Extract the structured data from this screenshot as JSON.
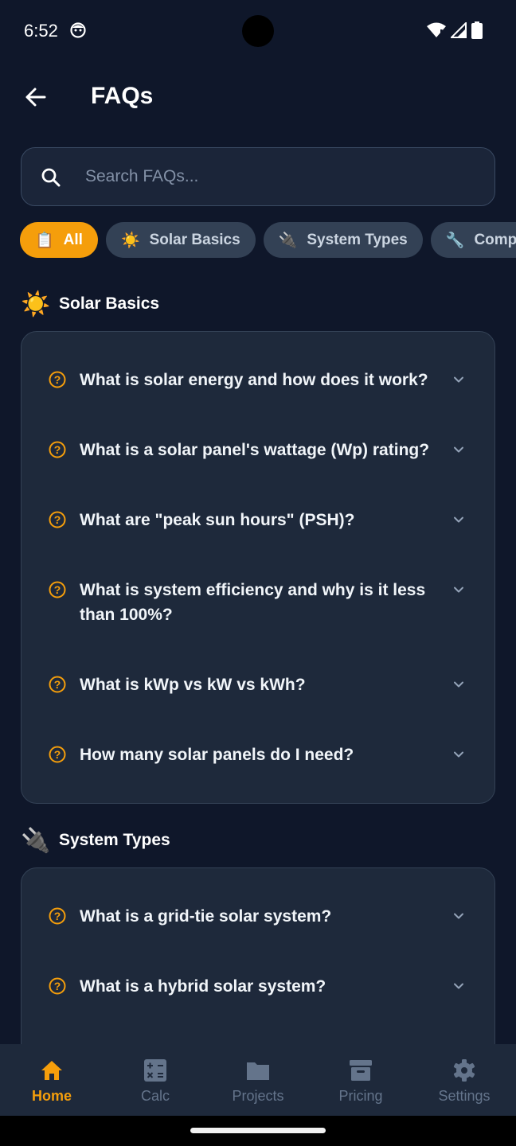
{
  "status_bar": {
    "time": "6:52"
  },
  "header": {
    "title": "FAQs"
  },
  "search": {
    "placeholder": "Search FAQs..."
  },
  "chips": [
    {
      "emoji": "📋",
      "label": "All",
      "active": true
    },
    {
      "emoji": "☀️",
      "label": "Solar Basics",
      "active": false
    },
    {
      "emoji": "🔌",
      "label": "System Types",
      "active": false
    },
    {
      "emoji": "🔧",
      "label": "Components",
      "active": false
    }
  ],
  "sections": [
    {
      "emoji": "☀️",
      "title": "Solar Basics",
      "questions": [
        "What is solar energy and how does it work?",
        "What is a solar panel's wattage (Wp) rating?",
        "What are \"peak sun hours\" (PSH)?",
        "What is system efficiency and why is it less than 100%?",
        "What is kWp vs kW vs kWh?",
        "How many solar panels do I need?"
      ]
    },
    {
      "emoji": "🔌",
      "title": "System Types",
      "questions": [
        "What is a grid-tie solar system?",
        "What is a hybrid solar system?"
      ]
    }
  ],
  "bottom_nav": [
    {
      "label": "Home",
      "icon": "home-icon",
      "active": true
    },
    {
      "label": "Calc",
      "icon": "calculator-icon",
      "active": false
    },
    {
      "label": "Projects",
      "icon": "folder-icon",
      "active": false
    },
    {
      "label": "Pricing",
      "icon": "archive-icon",
      "active": false
    },
    {
      "label": "Settings",
      "icon": "gear-icon",
      "active": false
    }
  ],
  "colors": {
    "accent": "#f59e0b",
    "background": "#0f172a",
    "card": "#1e293b",
    "chip": "#334155",
    "nav_inactive": "#64748b"
  }
}
